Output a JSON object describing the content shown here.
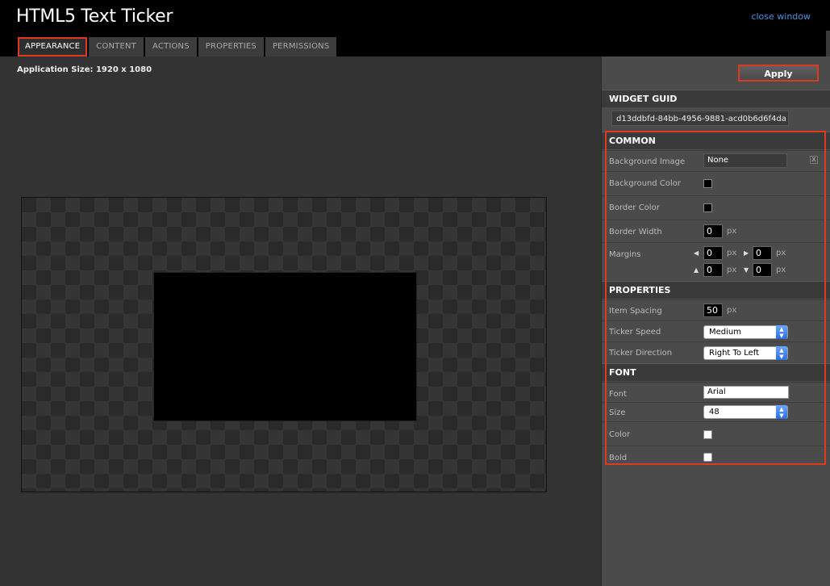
{
  "window": {
    "title": "HTML5 Text Ticker",
    "close_label": "close window"
  },
  "tabs": [
    {
      "label": "APPEARANCE",
      "active": true
    },
    {
      "label": "CONTENT"
    },
    {
      "label": "ACTIONS"
    },
    {
      "label": "PROPERTIES"
    },
    {
      "label": "PERMISSIONS"
    }
  ],
  "main": {
    "app_size": "Application Size: 1920 x 1080"
  },
  "panel": {
    "apply_label": "Apply",
    "guid": {
      "heading": "WIDGET GUID",
      "value": "d13ddbfd-84bb-4956-9881-acd0b6d6f4da"
    },
    "common": {
      "heading": "COMMON",
      "background_image": {
        "label": "Background Image",
        "value": "None",
        "clear": "x"
      },
      "background_color": {
        "label": "Background Color",
        "color": "#000000"
      },
      "border_color": {
        "label": "Border Color",
        "color": "#000000"
      },
      "border_width": {
        "label": "Border Width",
        "value": "0",
        "unit": "px"
      },
      "margins": {
        "label": "Margins",
        "left": "0",
        "right": "0",
        "top": "0",
        "bottom": "0",
        "unit": "px"
      }
    },
    "properties": {
      "heading": "PROPERTIES",
      "item_spacing": {
        "label": "Item Spacing",
        "value": "50",
        "unit": "px"
      },
      "ticker_speed": {
        "label": "Ticker Speed",
        "value": "Medium"
      },
      "ticker_direction": {
        "label": "Ticker Direction",
        "value": "Right To Left"
      }
    },
    "font": {
      "heading": "FONT",
      "font": {
        "label": "Font",
        "value": "Arial"
      },
      "size": {
        "label": "Size",
        "value": "48"
      },
      "color": {
        "label": "Color",
        "color": "#ffffff"
      },
      "bold": {
        "label": "Bold",
        "checked": false
      }
    }
  },
  "colors": {
    "accent_highlight": "#e03a1e",
    "link": "#4a8fe0"
  }
}
